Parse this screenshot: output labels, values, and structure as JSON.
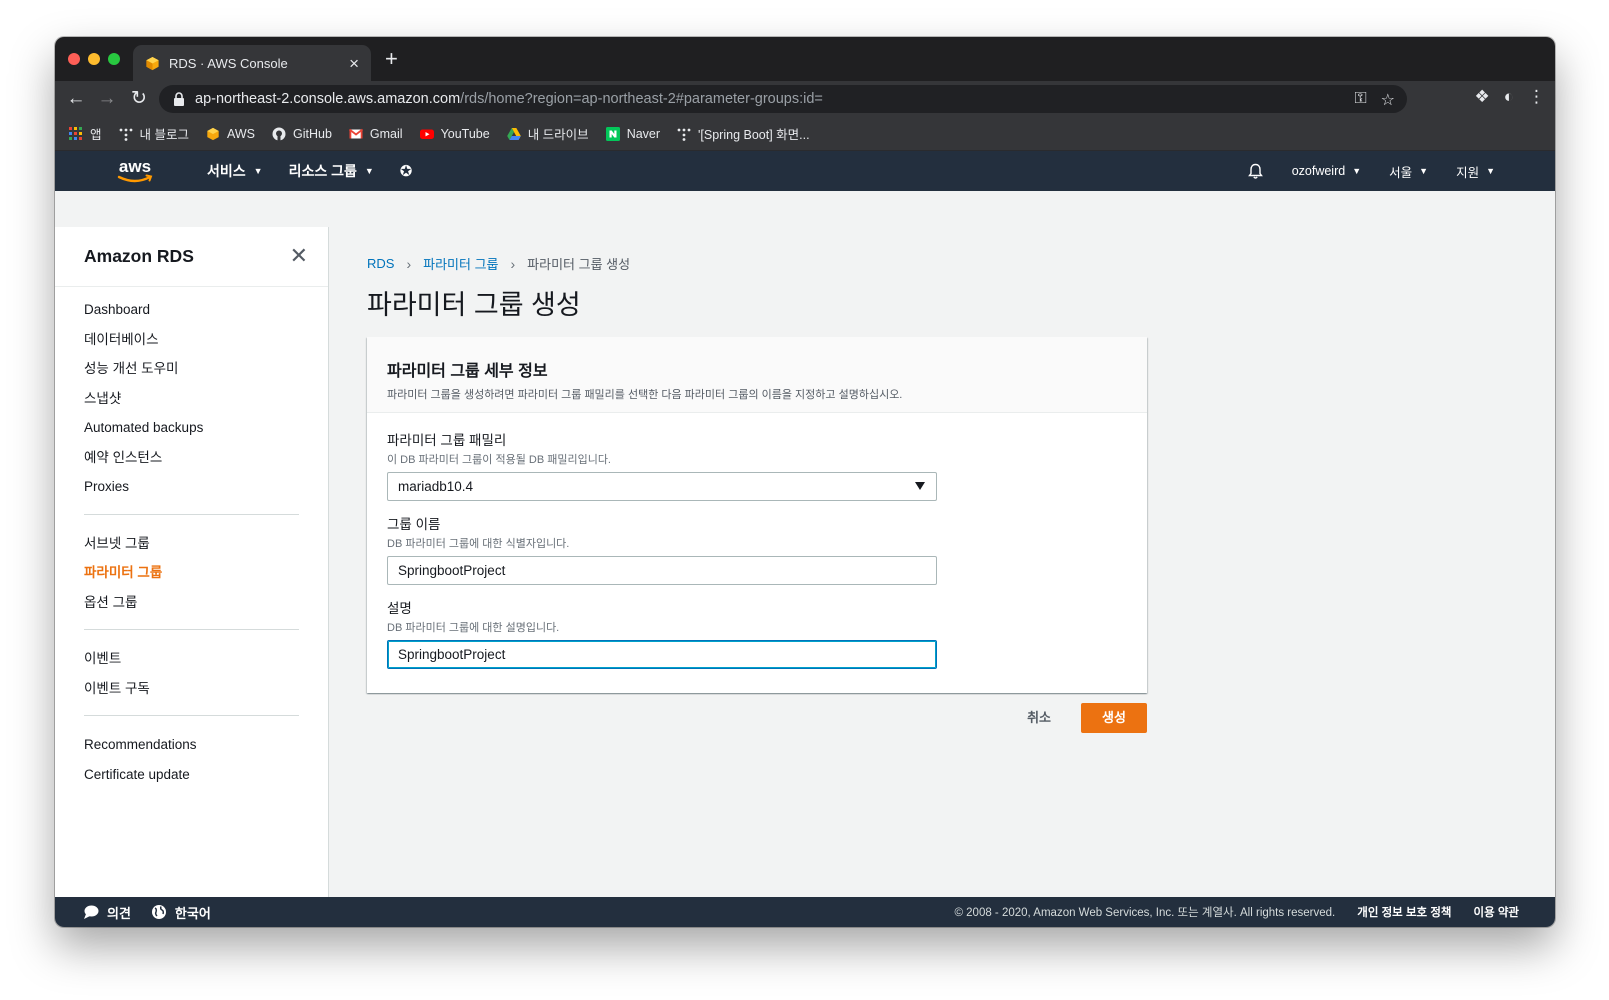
{
  "browser": {
    "tab_title": "RDS · AWS Console",
    "tab_close": "×",
    "new_tab": "+",
    "url_host": "ap-northeast-2.console.aws.amazon.com",
    "url_path": "/rds/home?region=ap-northeast-2#parameter-groups:id=",
    "bookmarks": [
      {
        "label": "앱",
        "icon": "apps-grid-icon"
      },
      {
        "label": "내 블로그",
        "icon": "tistory-icon"
      },
      {
        "label": "AWS",
        "icon": "aws-cube-icon"
      },
      {
        "label": "GitHub",
        "icon": "github-icon"
      },
      {
        "label": "Gmail",
        "icon": "gmail-icon"
      },
      {
        "label": "YouTube",
        "icon": "youtube-icon"
      },
      {
        "label": "내 드라이브",
        "icon": "google-drive-icon"
      },
      {
        "label": "Naver",
        "icon": "naver-icon"
      },
      {
        "label": "'[Spring Boot] 화면...",
        "icon": "tistory-icon"
      }
    ]
  },
  "aws_nav": {
    "logo": "aws",
    "services": "서비스",
    "resource_groups": "리소스 그룹",
    "username": "ozofweird",
    "region": "서울",
    "support": "지원"
  },
  "sidebar": {
    "title": "Amazon RDS",
    "sections": [
      [
        "Dashboard",
        "데이터베이스",
        "성능 개선 도우미",
        "스냅샷",
        "Automated backups",
        "예약 인스턴스",
        "Proxies"
      ],
      [
        "서브넷 그룹",
        "파라미터 그룹",
        "옵션 그룹"
      ],
      [
        "이벤트",
        "이벤트 구독"
      ],
      [
        "Recommendations",
        "Certificate update"
      ]
    ],
    "active_item": "파라미터 그룹"
  },
  "main": {
    "breadcrumb": {
      "root": "RDS",
      "parent": "파라미터 그룹",
      "current": "파라미터 그룹 생성"
    },
    "page_title": "파라미터 그룹 생성",
    "card": {
      "title": "파라미터 그룹 세부 정보",
      "description": "파라미터 그룹을 생성하려면 파라미터 그룹 패밀리를 선택한 다음 파라미터 그룹의 이름을 지정하고 설명하십시오.",
      "family": {
        "label": "파라미터 그룹 패밀리",
        "description": "이 DB 파라미터 그룹이 적용될 DB 패밀리입니다.",
        "value": "mariadb10.4"
      },
      "group_name": {
        "label": "그룹 이름",
        "description": "DB 파라미터 그룹에 대한 식별자입니다.",
        "value": "SpringbootProject"
      },
      "description_field": {
        "label": "설명",
        "description": "DB 파라미터 그룹에 대한 설명입니다.",
        "value": "SpringbootProject"
      }
    },
    "actions": {
      "cancel": "취소",
      "create": "생성"
    }
  },
  "footer": {
    "feedback": "의견",
    "language": "한국어",
    "copyright": "© 2008 - 2020, Amazon Web Services, Inc. 또는 계열사. All rights reserved.",
    "privacy": "개인 정보 보호 정책",
    "terms": "이용 약관"
  },
  "colors": {
    "aws_nav_bg": "#232f3e",
    "accent_orange": "#ec7211",
    "link_blue": "#0073bb",
    "page_bg": "#f2f3f3"
  }
}
